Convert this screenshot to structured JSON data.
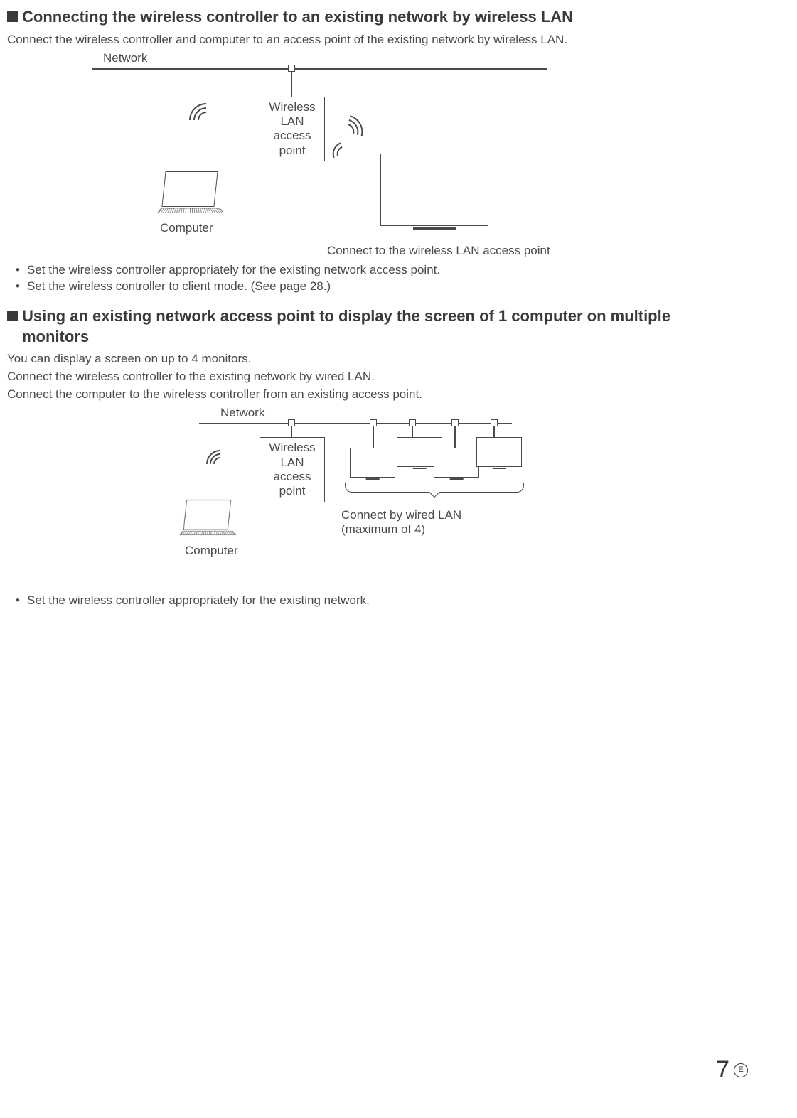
{
  "section1": {
    "title": "Connecting the wireless controller to an existing network by wireless LAN",
    "intro": "Connect the wireless controller and computer to an access point of the existing network by wireless LAN.",
    "fig": {
      "network_label": "Network",
      "ap_l1": "Wireless",
      "ap_l2": "LAN",
      "ap_l3": "access",
      "ap_l4": "point",
      "computer_label": "Computer",
      "caption": "Connect to the wireless LAN access point"
    },
    "bullets": [
      "Set the wireless controller appropriately for the existing network access point.",
      "Set the wireless controller to client mode. (See page 28.)"
    ]
  },
  "section2": {
    "title_l1": "Using an existing network access point to display the screen of 1 computer on multiple",
    "title_l2": "monitors",
    "intro1": "You can display a screen on up to 4 monitors.",
    "intro2": "Connect the wireless controller to the existing network by wired LAN.",
    "intro3": "Connect the computer to the wireless controller from an existing access point.",
    "fig": {
      "network_label": "Network",
      "ap_l1": "Wireless",
      "ap_l2": "LAN",
      "ap_l3": "access",
      "ap_l4": "point",
      "computer_label": "Computer",
      "caption_l1": "Connect by wired LAN",
      "caption_l2": "(maximum of 4)"
    },
    "bullets": [
      "Set the wireless controller appropriately for the existing network."
    ]
  },
  "page": {
    "number": "7",
    "lang": "E"
  }
}
